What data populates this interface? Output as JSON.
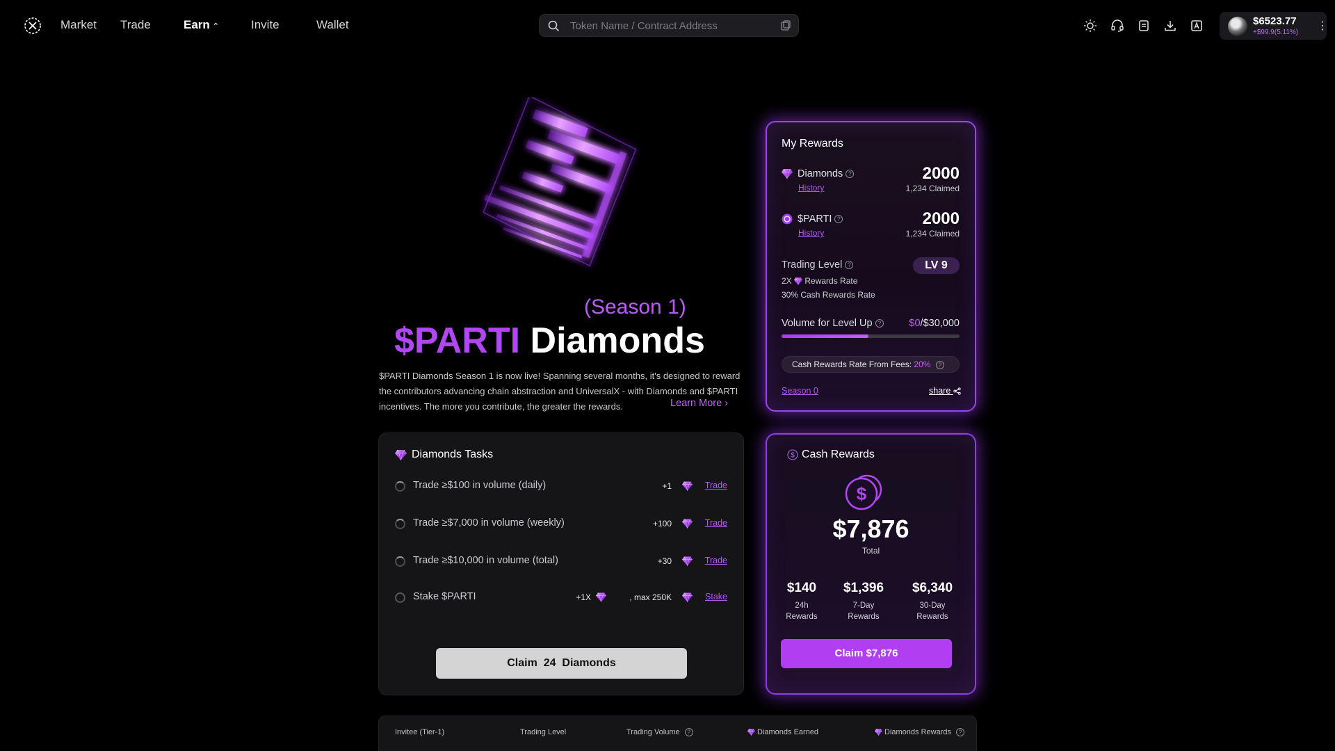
{
  "nav": {
    "items": [
      {
        "label": "Market"
      },
      {
        "label": "Trade"
      },
      {
        "label": "Earn",
        "active": true
      },
      {
        "label": "Invite"
      },
      {
        "label": "Wallet"
      }
    ]
  },
  "search": {
    "placeholder": "Token Name / Contract Address"
  },
  "header_icons": [
    "sun-icon",
    "headset-icon",
    "document-icon",
    "download-icon",
    "translate-icon"
  ],
  "wallet": {
    "balance": "$6523.77",
    "change": "+$99.9(5.11%)"
  },
  "hero": {
    "season": "(Season 1)",
    "title_accent": "$PARTI",
    "title_rest": "Diamonds",
    "description": "$PARTI Diamonds Season 1 is now live! Spanning several months, it's designed to reward the contributors advancing chain abstraction and UniversalX - with Diamonds and $PARTI incentives. The more you contribute, the greater the rewards.",
    "learn_more": "Learn More"
  },
  "my_rewards": {
    "title": "My Rewards",
    "diamonds": {
      "label": "Diamonds",
      "history": "History",
      "value": "2000",
      "claimed": "1,234 Claimed"
    },
    "parti": {
      "label": "$PARTI",
      "history": "History",
      "value": "2000",
      "claimed": "1,234 Claimed"
    },
    "trading_level": {
      "label": "Trading Level",
      "badge": "LV 9",
      "rewards_rate_prefix": "2X",
      "rewards_rate_suffix": "Rewards Rate",
      "cash_rate": "30% Cash Rewards Rate"
    },
    "volume": {
      "label": "Volume for Level Up",
      "current": "$0",
      "target": "/$30,000",
      "progress": 0.49
    },
    "cash_fee": {
      "label": "Cash Rewards Rate From Fees:",
      "value": "20%"
    },
    "season0": "Season 0",
    "share": "share"
  },
  "tasks": {
    "title": "Diamonds Tasks",
    "items": [
      {
        "text": "Trade ≥$100 in volume (daily)",
        "points": "+1",
        "link": "Trade"
      },
      {
        "text": "Trade ≥$7,000 in volume (weekly)",
        "points": "+100",
        "link": "Trade"
      },
      {
        "text": "Trade ≥$10,000 in volume (total)",
        "points": "+30",
        "link": "Trade"
      },
      {
        "text": "Stake $PARTI",
        "points": "+1X",
        "extra": ", max 250K",
        "link": "Stake"
      }
    ],
    "claim_prefix": "Claim",
    "claim_count": "24",
    "claim_suffix": "Diamonds"
  },
  "cash_rewards": {
    "title": "Cash Rewards",
    "total": "$7,876",
    "total_label": "Total",
    "stats": [
      {
        "value": "$140",
        "label1": "24h",
        "label2": "Rewards"
      },
      {
        "value": "$1,396",
        "label1": "7-Day",
        "label2": "Rewards"
      },
      {
        "value": "$6,340",
        "label1": "30-Day",
        "label2": "Rewards"
      }
    ],
    "claim_label": "Claim $7,876"
  },
  "invitee_table": {
    "headers": [
      "Invitee (Tier-1)",
      "Trading Level",
      "Trading Volume",
      "Diamonds Earned",
      "Diamonds Rewards"
    ]
  },
  "colors": {
    "accent": "#b146f3",
    "link": "#b358f2",
    "button": "#b13ff1"
  }
}
